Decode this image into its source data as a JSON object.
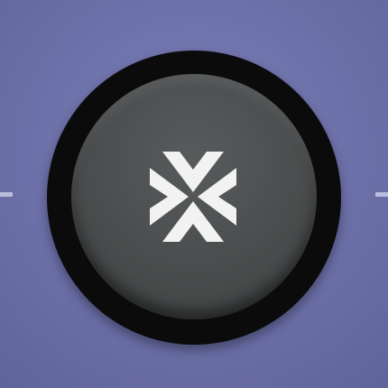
{
  "background": {
    "color": "#6c70a8"
  },
  "button": {
    "label": "",
    "icon": "collapse-arrows-icon",
    "colors": {
      "ring": "#0b0b0c",
      "face": "#4a4c4d",
      "glyph": "#f2f2f2"
    }
  }
}
